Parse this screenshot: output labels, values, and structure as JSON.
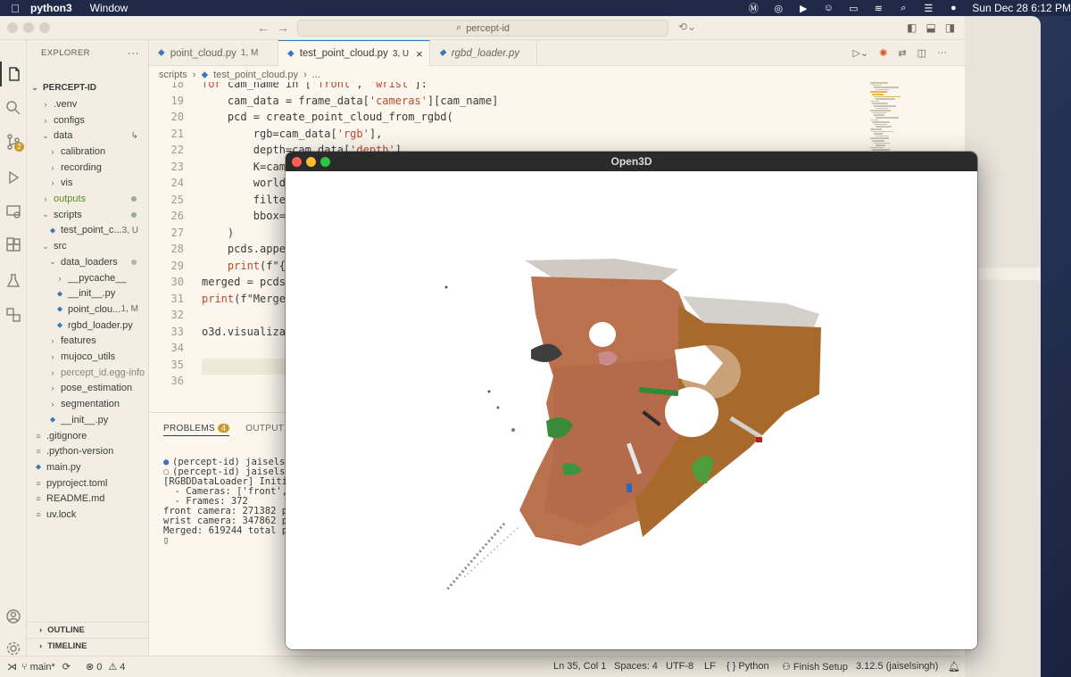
{
  "menubar": {
    "app_name": "python3",
    "menu_window": "Window",
    "clock": "Sun Dec 28  6:12 PM"
  },
  "titlebar": {
    "search_text": "percept-id"
  },
  "activity": {
    "scm_badge": "2"
  },
  "sidebar": {
    "header": "EXPLORER",
    "more": "···",
    "root": "PERCEPT-ID",
    "items": [
      {
        "label": ".venv",
        "chev": "›"
      },
      {
        "label": "configs",
        "chev": "›"
      },
      {
        "label": "data",
        "chev": "⌄",
        "meta": "↳"
      },
      {
        "label": "calibration",
        "chev": "›"
      },
      {
        "label": "recording",
        "chev": "›"
      },
      {
        "label": "vis",
        "chev": "›"
      },
      {
        "label": "outputs",
        "chev": "›"
      },
      {
        "label": "scripts",
        "chev": "⌄"
      },
      {
        "label": "test_point_c...",
        "meta": "3, U"
      },
      {
        "label": "src",
        "chev": "⌄"
      },
      {
        "label": "data_loaders",
        "chev": "⌄"
      },
      {
        "label": "__pycache__",
        "chev": "›"
      },
      {
        "label": "__init__.py"
      },
      {
        "label": "point_clou...",
        "meta": "1, M"
      },
      {
        "label": "rgbd_loader.py"
      },
      {
        "label": "features",
        "chev": "›"
      },
      {
        "label": "mujoco_utils",
        "chev": "›"
      },
      {
        "label": "percept_id.egg-info",
        "chev": "›"
      },
      {
        "label": "pose_estimation",
        "chev": "›"
      },
      {
        "label": "segmentation",
        "chev": "›"
      },
      {
        "label": "__init__.py"
      },
      {
        "label": ".gitignore"
      },
      {
        "label": ".python-version"
      },
      {
        "label": "main.py"
      },
      {
        "label": "pyproject.toml"
      },
      {
        "label": "README.md"
      },
      {
        "label": "uv.lock"
      }
    ],
    "outline": "OUTLINE",
    "timeline": "TIMELINE"
  },
  "tabs": [
    {
      "label": "point_cloud.py",
      "suffix": "1, M"
    },
    {
      "label": "test_point_cloud.py",
      "suffix": "3, U",
      "close": "×"
    },
    {
      "label": "rgbd_loader.py"
    }
  ],
  "breadcrumb": {
    "folder": "scripts",
    "sep": "›",
    "file": "test_point_cloud.py",
    "tail": "..."
  },
  "editor": {
    "lines": [
      {
        "n": "18",
        "code": "for cam_name in ['front', 'wrist']:"
      },
      {
        "n": "19",
        "code": "    cam_data = frame_data['cameras'][cam_name]"
      },
      {
        "n": "20",
        "code": "    pcd = create_point_cloud_from_rgbd("
      },
      {
        "n": "21",
        "code": "        rgb=cam_data['rgb'],"
      },
      {
        "n": "22",
        "code": "        depth=cam_data['depth'],"
      },
      {
        "n": "23",
        "code": "        K=cam_"
      },
      {
        "n": "24",
        "code": "        world_"
      },
      {
        "n": "25",
        "code": "        filter"
      },
      {
        "n": "26",
        "code": "        bbox=b"
      },
      {
        "n": "27",
        "code": "    )"
      },
      {
        "n": "28",
        "code": "    pcds.appen"
      },
      {
        "n": "29",
        "code": "    print(f\"{c"
      },
      {
        "n": "30",
        "code": "merged = pcds["
      },
      {
        "n": "31",
        "code": "print(f\"Merge"
      },
      {
        "n": "32",
        "code": ""
      },
      {
        "n": "33",
        "code": "o3d.visualizat"
      },
      {
        "n": "34",
        "code": ""
      },
      {
        "n": "35",
        "code": ""
      },
      {
        "n": "36",
        "code": ""
      }
    ]
  },
  "panel": {
    "problems": "PROBLEMS",
    "problems_count": "4",
    "output": "OUTPUT",
    "terminal": [
      {
        "mark": "●",
        "text": "(percept-id) jaiselsingh"
      },
      {
        "mark": "○",
        "text": "(percept-id) jaiselsingh"
      },
      {
        "mark": "",
        "text": "[RGBDDataLoader] Initial"
      },
      {
        "mark": "",
        "text": "  - Cameras: ['front', '"
      },
      {
        "mark": "",
        "text": "  - Frames: 372"
      },
      {
        "mark": "",
        "text": "front camera: 271382 poi"
      },
      {
        "mark": "",
        "text": "wrist camera: 347862 poi"
      },
      {
        "mark": "",
        "text": "Merged: 619244 total poi"
      },
      {
        "mark": "",
        "text": "▯"
      }
    ]
  },
  "statusbar": {
    "branch": "main*",
    "errors": "0",
    "warnings": "4",
    "position": "Ln 35, Col 1",
    "spaces": "Spaces: 4",
    "encoding": "UTF-8",
    "eol": "LF",
    "language": "Python",
    "finish_setup": "Finish Setup",
    "interpreter": "3.12.5 (jaiselsingh)"
  },
  "open3d": {
    "title": "Open3D"
  },
  "colors": {
    "accent": "#3c78b5",
    "badge": "#c89b2c",
    "vscode_bg": "#fbf7ee",
    "close_red": "#ff5f57",
    "minimize_yellow": "#febc2e",
    "zoom_green": "#28c840"
  }
}
